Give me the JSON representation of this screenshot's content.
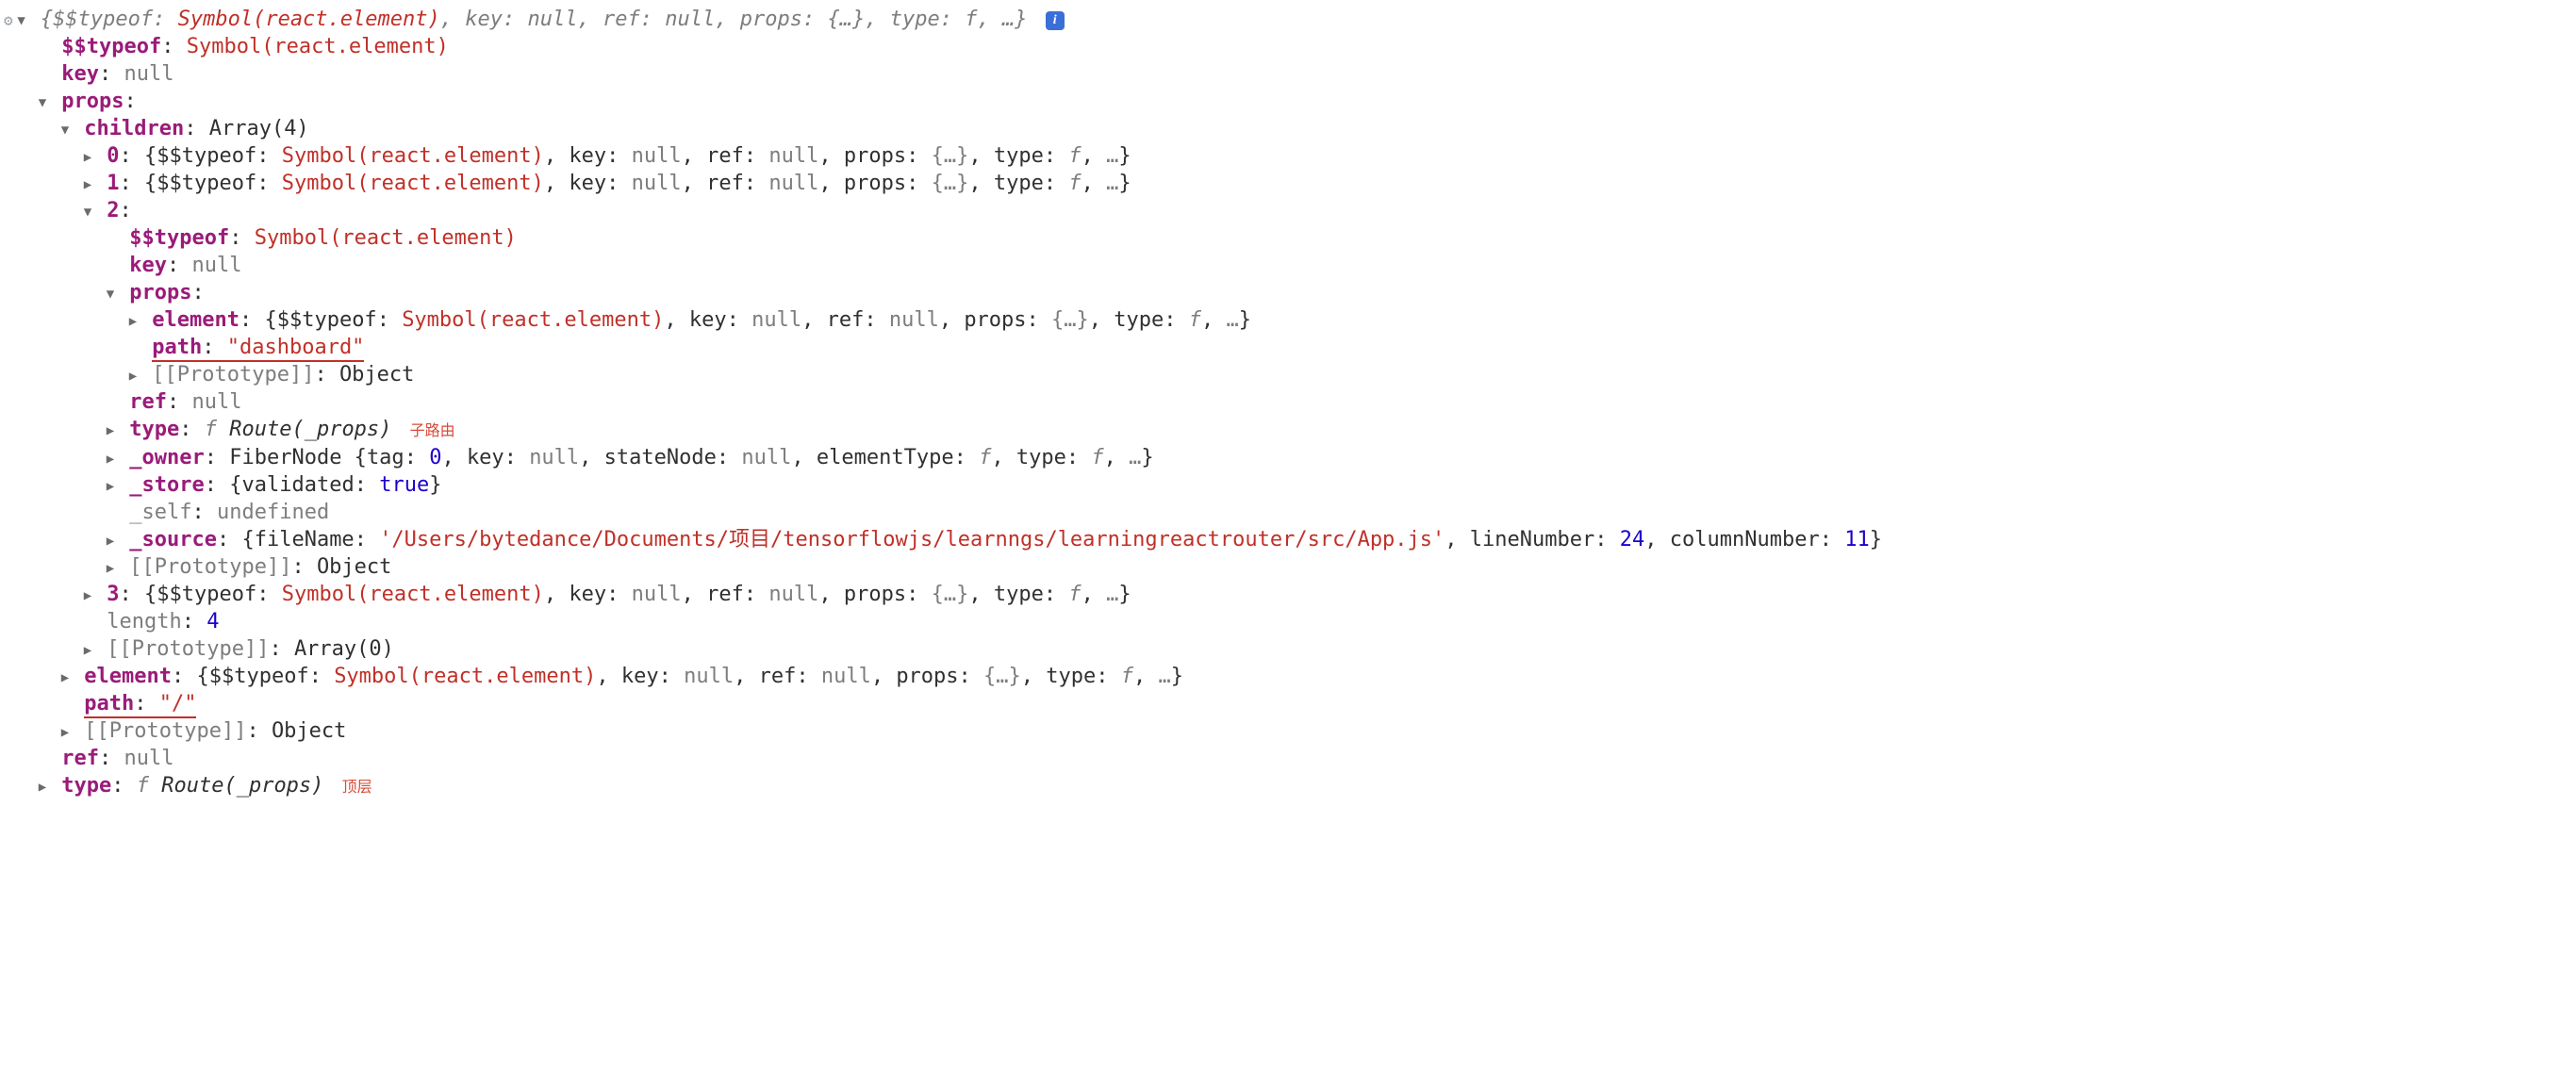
{
  "arrows": {
    "down": "▼",
    "right": "▶"
  },
  "info_badge": "i",
  "top_preview": {
    "typeof_k": "$$typeof",
    "typeof_v": "Symbol(react.element)",
    "key_k": "key",
    "key_v": "null",
    "ref_k": "ref",
    "ref_v": "null",
    "props_k": "props",
    "props_v": "{…}",
    "type_k": "type",
    "type_v": "f",
    "ell": "…"
  },
  "l1_typeof": {
    "k": "$$typeof",
    "v": "Symbol(react.element)"
  },
  "l1_key": {
    "k": "key",
    "v": "null"
  },
  "l1_props": {
    "k": "props"
  },
  "children_hdr": {
    "k": "children",
    "v": "Array(4)"
  },
  "child_preview": {
    "typeof_k": "$$typeof",
    "typeof_v": "Symbol(react.element)",
    "key_k": "key",
    "key_v": "null",
    "ref_k": "ref",
    "ref_v": "null",
    "props_k": "props",
    "props_v": "{…}",
    "type_k": "type",
    "type_v": "f",
    "ell": "…"
  },
  "idx0": "0",
  "idx1": "1",
  "idx2": "2",
  "idx3": "3",
  "c2_typeof": {
    "k": "$$typeof",
    "v": "Symbol(react.element)"
  },
  "c2_key": {
    "k": "key",
    "v": "null"
  },
  "c2_props": {
    "k": "props"
  },
  "c2_element": {
    "k": "element"
  },
  "c2_path": {
    "k": "path",
    "v": "\"dashboard\""
  },
  "c2_proto": {
    "k": "[[Prototype]]",
    "v": "Object"
  },
  "c2_ref": {
    "k": "ref",
    "v": "null"
  },
  "c2_type": {
    "k": "type",
    "func": "f",
    "sig": "Route(_props)"
  },
  "anno_sub": "子路由",
  "c2_owner": {
    "k": "_owner",
    "pre": "FiberNode {",
    "tag_k": "tag",
    "tag_v": "0",
    "key_k": "key",
    "key_v": "null",
    "sn_k": "stateNode",
    "sn_v": "null",
    "et_k": "elementType",
    "et_v": "f",
    "ty_k": "type",
    "ty_v": "f",
    "ell": "…"
  },
  "c2_store": {
    "k": "_store",
    "validated_k": "validated",
    "validated_v": "true"
  },
  "c2_self": {
    "k": "_self",
    "v": "undefined"
  },
  "c2_source": {
    "k": "_source",
    "fn_k": "fileName",
    "fn_v": "'/Users/bytedance/Documents/项目/tensorflowjs/learnngs/learningreactrouter/src/App.js'",
    "ln_k": "lineNumber",
    "ln_v": "24",
    "cn_k": "columnNumber",
    "cn_v": "11"
  },
  "children_proto": {
    "k": "[[Prototype]]",
    "v": "Object"
  },
  "children_length": {
    "k": "length",
    "v": "4"
  },
  "children_arrproto": {
    "k": "[[Prototype]]",
    "v": "Array(0)"
  },
  "outer_element": {
    "k": "element"
  },
  "outer_path": {
    "k": "path",
    "v": "\"/\""
  },
  "outer_proto": {
    "k": "[[Prototype]]",
    "v": "Object"
  },
  "l1_ref": {
    "k": "ref",
    "v": "null"
  },
  "l1_type": {
    "k": "type",
    "func": "f",
    "sig": "Route(_props)"
  },
  "anno_top": "顶层"
}
